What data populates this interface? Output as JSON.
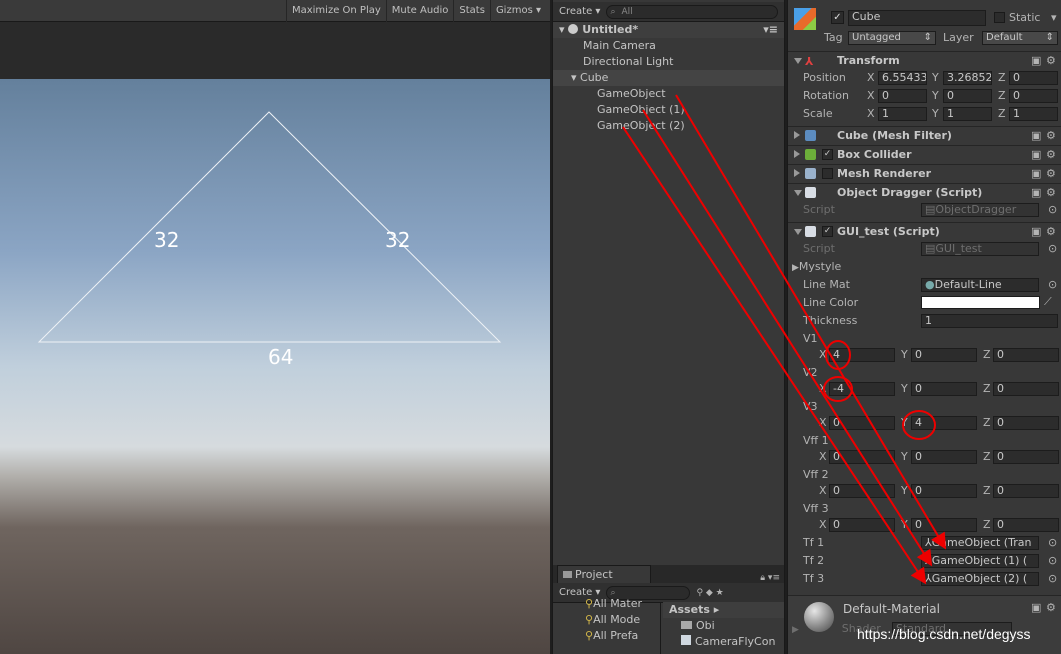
{
  "game_toolbar": {
    "maximize": "Maximize On Play",
    "mute": "Mute Audio",
    "stats": "Stats",
    "gizmos": "Gizmos"
  },
  "triangle": {
    "left_label": "32",
    "right_label": "32",
    "bottom_label": "64"
  },
  "hierarchy": {
    "create": "Create",
    "search_placeholder": "All",
    "scene": "Untitled*",
    "items": [
      "Main Camera",
      "Directional Light",
      "Cube",
      "GameObject",
      "GameObject (1)",
      "GameObject (2)"
    ]
  },
  "project": {
    "tab": "Project",
    "create": "Create",
    "favorites": [
      "All Mater",
      "All Mode",
      "All Prefa"
    ],
    "assets": "Assets",
    "asset_items": [
      "Obi",
      "CameraFlyCon"
    ]
  },
  "inspector": {
    "name": "Cube",
    "static": "Static",
    "tag_label": "Tag",
    "tag": "Untagged",
    "layer_label": "Layer",
    "layer": "Default",
    "transform": {
      "title": "Transform",
      "position": "Position",
      "rotation": "Rotation",
      "scale": "Scale",
      "pos": [
        "6.55433",
        "3.26852",
        "0"
      ],
      "rot": [
        "0",
        "0",
        "0"
      ],
      "scl": [
        "1",
        "1",
        "1"
      ]
    },
    "mesh_filter": "Cube (Mesh Filter)",
    "box_collider": "Box Collider",
    "mesh_renderer": "Mesh Renderer",
    "object_dragger": {
      "title": "Object Dragger (Script)",
      "script_label": "Script",
      "script": "ObjectDragger"
    },
    "gui_test": {
      "title": "GUI_test (Script)",
      "script_label": "Script",
      "script": "GUI_test",
      "mystyle": "Mystyle",
      "line_mat_label": "Line Mat",
      "line_mat": "Default-Line",
      "line_color_label": "Line Color",
      "thickness_label": "Thickness",
      "thickness": "1",
      "v1_label": "V1",
      "v1": [
        "4",
        "0",
        "0"
      ],
      "v2_label": "V2",
      "v2": [
        "-4",
        "0",
        "0"
      ],
      "v3_label": "V3",
      "v3": [
        "0",
        "4",
        "0"
      ],
      "vff1_label": "Vff 1",
      "vff1": [
        "0",
        "0",
        "0"
      ],
      "vff2_label": "Vff 2",
      "vff2": [
        "0",
        "0",
        "0"
      ],
      "vff3_label": "Vff 3",
      "vff3": [
        "0",
        "0",
        "0"
      ],
      "tf1_label": "Tf 1",
      "tf1": "GameObject (Tran",
      "tf2_label": "Tf 2",
      "tf2": "GameObject (1) (",
      "tf3_label": "Tf 3",
      "tf3": "GameObject (2) ("
    },
    "material": "Default-Material",
    "shader_label": "Shader",
    "shader": "Standard",
    "axes": {
      "x": "X",
      "y": "Y",
      "z": "Z"
    }
  },
  "watermark": "https://blog.csdn.net/degyss"
}
